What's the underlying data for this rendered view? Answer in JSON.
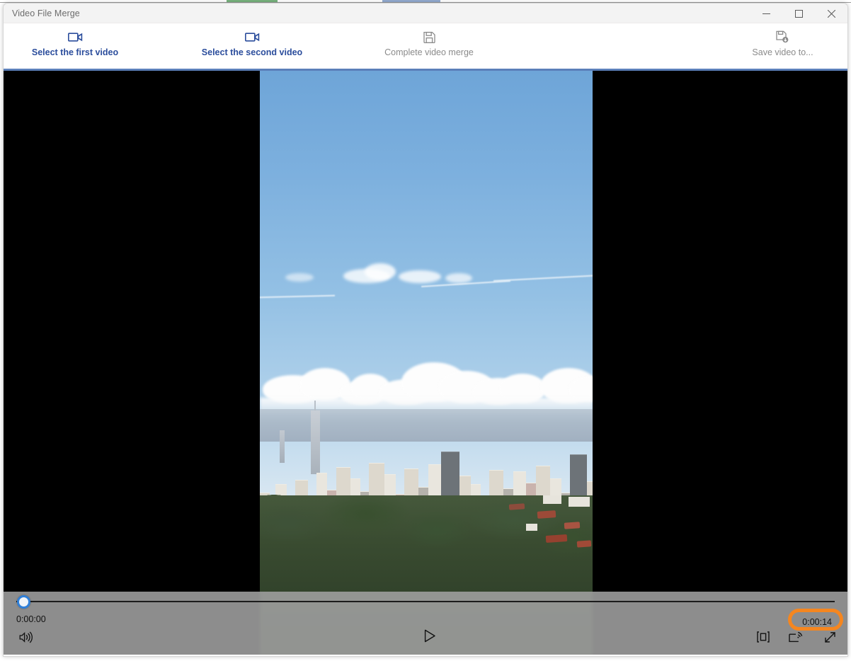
{
  "window": {
    "title": "Video File Merge",
    "controls": {
      "minimize": "minimize-button",
      "maximize": "maximize-button",
      "close": "close-button"
    }
  },
  "toolbar": {
    "items": [
      {
        "id": "select-first-video",
        "label": "Select the first video",
        "icon": "video-camera-icon",
        "state": "enabled",
        "color": "#2b4d9c"
      },
      {
        "id": "select-second-video",
        "label": "Select the second video",
        "icon": "video-camera-icon",
        "state": "enabled",
        "color": "#2b4d9c"
      },
      {
        "id": "complete-video-merge",
        "label": "Complete video merge",
        "icon": "save-disk-icon",
        "state": "disabled",
        "color": "#8a8a8a"
      },
      {
        "id": "save-video-to",
        "label": "Save video to...",
        "icon": "save-as-icon",
        "state": "disabled",
        "color": "#8a8a8a"
      }
    ],
    "accent_underline": "#5b7fb9"
  },
  "player": {
    "letterbox_color": "#000000",
    "video_description": "Aerial view of a city skyline with tall apartment towers, cumulus clouds and a forested hillside in the foreground",
    "seek": {
      "position_percent": 0,
      "thumb_color": "#2f7fd8",
      "track_color": "#1c1c1c"
    },
    "time_current": "0:00:00",
    "time_total": "0:00:14",
    "annotation": {
      "target": "time_total",
      "shape": "rounded-rectangle",
      "color": "#f5861f"
    },
    "buttons": {
      "volume": "Volume",
      "play": "Play",
      "fit": "Fit to window",
      "cast": "Cast to device",
      "fullscreen": "Full screen"
    }
  }
}
